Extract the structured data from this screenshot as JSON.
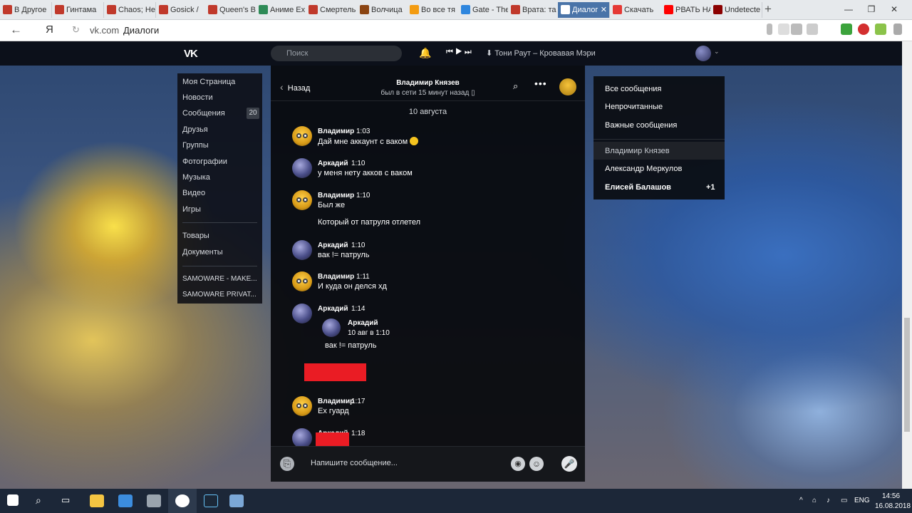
{
  "browser": {
    "tabs": [
      {
        "label": "В Другое",
        "fav": "#c0392b"
      },
      {
        "label": "Гинтама",
        "fav": "#c0392b"
      },
      {
        "label": "Chaos; He",
        "fav": "#c0392b"
      },
      {
        "label": "Gosick /",
        "fav": "#c0392b"
      },
      {
        "label": "Queen's B",
        "fav": "#c0392b"
      },
      {
        "label": "Аниме Ex",
        "fav": "#2e8b57"
      },
      {
        "label": "Смертель",
        "fav": "#c0392b"
      },
      {
        "label": "Волчица",
        "fav": "#8b4513"
      },
      {
        "label": "Во все тя",
        "fav": "#f39c12"
      },
      {
        "label": "Gate - The",
        "fav": "#2e86de"
      },
      {
        "label": "Врата: та",
        "fav": "#c0392b"
      },
      {
        "label": "Диалог",
        "fav": "#ffffff",
        "active": true
      },
      {
        "label": "Скачать",
        "fav": "#e53935"
      },
      {
        "label": "РВАТЬ НА",
        "fav": "#ff0000"
      },
      {
        "label": "Undetecte",
        "fav": "#8b0000"
      }
    ],
    "url_host": "vk.com",
    "url_title": "Диалоги",
    "yandex_logo": "Я"
  },
  "vk_header": {
    "logo": "VK",
    "search_placeholder": "Поиск",
    "track": "Тони Раут – Кровавая Мэри"
  },
  "left_menu": {
    "items": [
      "Моя Страница",
      "Новости",
      "Сообщения",
      "Друзья",
      "Группы",
      "Фотографии",
      "Музыка",
      "Видео",
      "Игры"
    ],
    "items2": [
      "Товары",
      "Документы"
    ],
    "items3": [
      "SAMOWARE - MAKE...",
      "SAMOWARE PRIVAT..."
    ],
    "messages_badge": "20"
  },
  "chat": {
    "back_label": "Назад",
    "contact_name": "Владимир Князев",
    "contact_status": "был в сети 15 минут назад",
    "date_separator": "10 августа",
    "messages": [
      {
        "author": "Владимир",
        "time": "1:03",
        "text": "Дай мне аккаунт с ваком",
        "avatar": "v"
      },
      {
        "author": "Аркадий",
        "time": "1:10",
        "text": "у меня нету акков с ваком",
        "avatar": "a"
      },
      {
        "author": "Владимир",
        "time": "1:10",
        "text": "Был же",
        "text2": "Который от патруля отлетел",
        "avatar": "v"
      },
      {
        "author": "Аркадий",
        "time": "1:10",
        "text": "вак != патруль",
        "avatar": "a"
      },
      {
        "author": "Владимир",
        "time": "1:11",
        "text": "И куда он делся хд",
        "avatar": "v"
      },
      {
        "author": "Аркадий",
        "time": "1:14",
        "avatar": "a"
      },
      {
        "author": "Владимир",
        "time": "1:17",
        "text": "Ex гуард",
        "avatar": "v"
      },
      {
        "author": "Аркадий",
        "time": "1:18",
        "avatar": "a"
      }
    ],
    "forwarded": {
      "author": "Аркадий",
      "date": "10 авг в 1:10",
      "text": "вак != патруль"
    },
    "composer_placeholder": "Напишите сообщение..."
  },
  "right_panel": {
    "filters": [
      "Все сообщения",
      "Непрочитанные",
      "Важные сообщения"
    ],
    "dialogs": [
      "Владимир Князев",
      "Александр Меркулов",
      "Елисей Балашов"
    ],
    "unread_count": "+1"
  },
  "taskbar": {
    "language": "ENG",
    "time": "14:56",
    "date": "16.08.2018"
  },
  "colors": {
    "redaction": "#ea1c24",
    "active_tab": "#4a74a8"
  }
}
